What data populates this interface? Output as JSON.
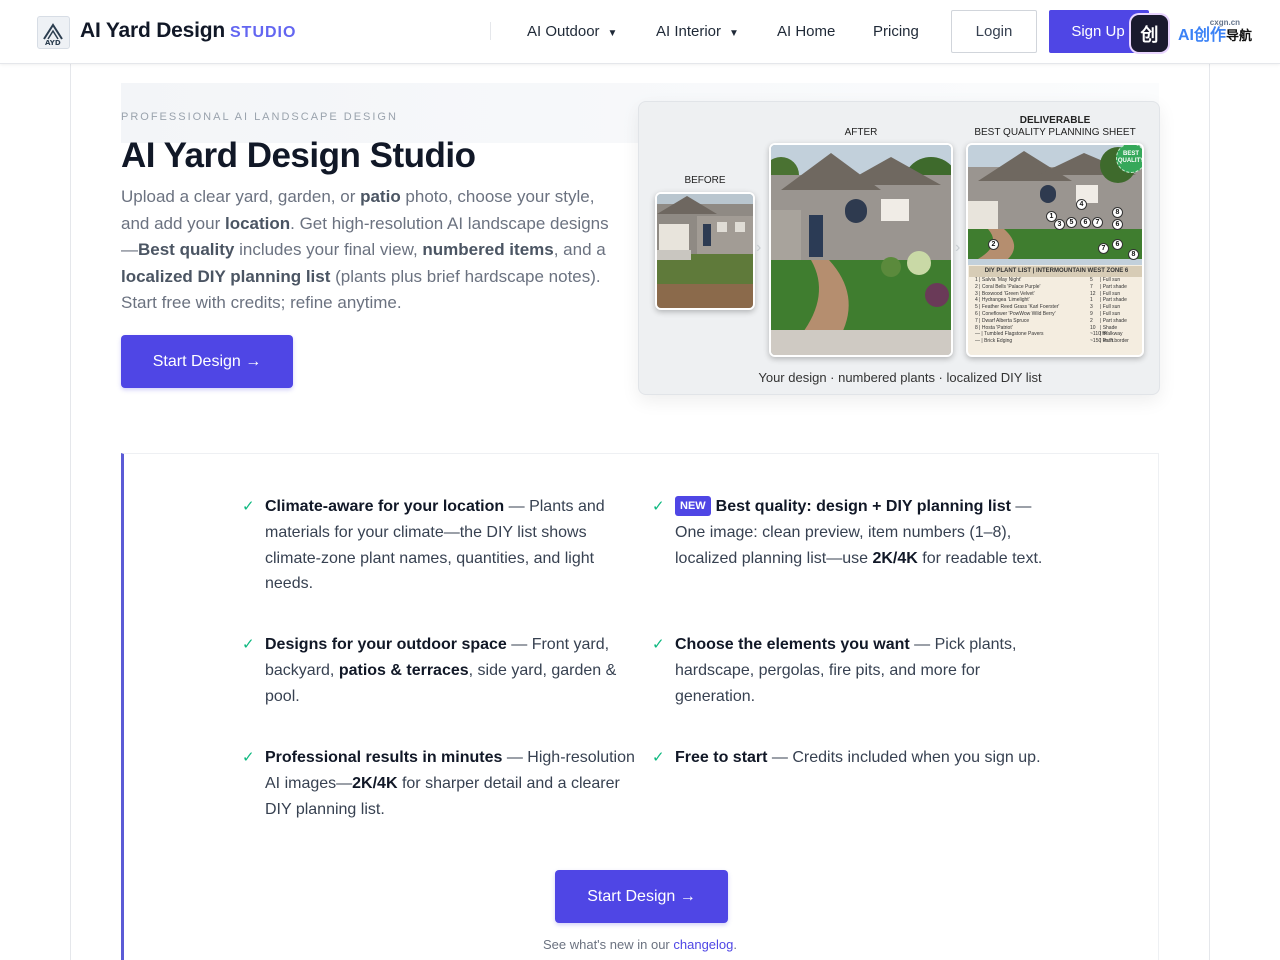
{
  "header": {
    "brand": "AI Yard Design",
    "brand_suffix": "STUDIO",
    "nav": [
      {
        "label": "AI Outdoor",
        "has_dropdown": true
      },
      {
        "label": "AI Interior",
        "has_dropdown": true
      },
      {
        "label": "AI Home",
        "has_dropdown": false
      },
      {
        "label": "Pricing",
        "has_dropdown": false
      }
    ],
    "login_label": "Login",
    "signup_label": "Sign Up",
    "app_badge_glyph": "创",
    "lang_badge": "AI创作",
    "lang_badge_sub": "导航",
    "lang_badge_small": "cxgn.cn"
  },
  "hero": {
    "eyebrow": "PROFESSIONAL AI LANDSCAPE DESIGN",
    "title": "AI Yard Design Studio",
    "desc_parts": [
      {
        "t": "Upload a clear yard, garden, or ",
        "b": false
      },
      {
        "t": "patio",
        "b": true
      },
      {
        "t": " photo, choose your style, and add your ",
        "b": false
      },
      {
        "t": "location",
        "b": true
      },
      {
        "t": ". Get high-resolution AI landscape designs —",
        "b": false
      },
      {
        "t": "Best quality",
        "b": true
      },
      {
        "t": " includes your final view, ",
        "b": false
      },
      {
        "t": "numbered items",
        "b": true
      },
      {
        "t": ", and a ",
        "b": false
      },
      {
        "t": "localized DIY planning list",
        "b": true
      },
      {
        "t": " (plants plus brief hardscape notes). Start free with credits; refine anytime.",
        "b": false
      }
    ],
    "cta_label": "Start Design →"
  },
  "showcase": {
    "before_label": "BEFORE",
    "after_label": "AFTER",
    "deliverable_label": "DELIVERABLE",
    "deliverable_sub": "BEST QUALITY PLANNING SHEET",
    "best_badge": "BEST QUALITY",
    "caption": "Your design · numbered plants · localized DIY list",
    "plan_list_title": "DIY PLANT LIST | INTERMOUNTAIN WEST ZONE 6",
    "plan_rows": [
      {
        "n": "1",
        "name": "Salvia 'May Night'",
        "q": "5",
        "l": "Full sun"
      },
      {
        "n": "2",
        "name": "Coral Bells 'Palace Purple'",
        "q": "7",
        "l": "Part shade"
      },
      {
        "n": "3",
        "name": "Boxwood 'Green Velvet'",
        "q": "12",
        "l": "Full sun"
      },
      {
        "n": "4",
        "name": "Hydrangea 'Limelight'",
        "q": "1",
        "l": "Part shade"
      },
      {
        "n": "5",
        "name": "Feather Reed Grass 'Karl Foerster'",
        "q": "3",
        "l": "Full sun"
      },
      {
        "n": "6",
        "name": "Coneflower 'PowWow Wild Berry'",
        "q": "9",
        "l": "Full sun"
      },
      {
        "n": "7",
        "name": "Dwarf Alberta Spruce",
        "q": "2",
        "l": "Part shade"
      },
      {
        "n": "8",
        "name": "Hosta 'Patriot'",
        "q": "10",
        "l": "Shade"
      },
      {
        "n": "—",
        "name": "Tumbled Flagstone Pavers",
        "q": "~110 ft²",
        "l": "Walkway"
      },
      {
        "n": "—",
        "name": "Brick Edging",
        "q": "~150 lin. ft.",
        "l": "Path border"
      }
    ],
    "pins": [
      "1",
      "2",
      "3",
      "4",
      "5",
      "6",
      "7",
      "8",
      "6",
      "7",
      "6",
      "8"
    ]
  },
  "features": [
    {
      "id": "climate",
      "parts": [
        {
          "t": "Climate-aware for your location",
          "b": true
        },
        {
          "t": " — Plants and materials for your climate—the DIY list shows climate-zone plant names, quantities, and light needs.",
          "b": false
        }
      ]
    },
    {
      "id": "best-quality",
      "new": "NEW",
      "parts": [
        {
          "t": "Best quality: design + DIY planning list",
          "b": true
        },
        {
          "t": " — One image: clean preview, item numbers (1–8), localized planning list—use ",
          "b": false
        },
        {
          "t": "2K/4K",
          "b": true
        },
        {
          "t": " for readable text.",
          "b": false
        }
      ]
    },
    {
      "id": "outdoor-space",
      "parts": [
        {
          "t": "Designs for your outdoor space",
          "b": true
        },
        {
          "t": " — Front yard, backyard, ",
          "b": false
        },
        {
          "t": "patios & terraces",
          "b": true
        },
        {
          "t": ", side yard, garden & pool.",
          "b": false
        }
      ]
    },
    {
      "id": "elements",
      "parts": [
        {
          "t": "Choose the elements you want",
          "b": true
        },
        {
          "t": " — Pick plants, hardscape, pergolas, fire pits, and more for generation.",
          "b": false
        }
      ]
    },
    {
      "id": "results",
      "parts": [
        {
          "t": "Professional results in minutes",
          "b": true
        },
        {
          "t": " — High-resolution AI images—",
          "b": false
        },
        {
          "t": "2K/4K",
          "b": true
        },
        {
          "t": " for sharper detail and a clearer DIY planning list.",
          "b": false
        }
      ]
    },
    {
      "id": "free",
      "parts": [
        {
          "t": "Free to start",
          "b": true
        },
        {
          "t": " — Credits included when you sign up.",
          "b": false
        }
      ]
    }
  ],
  "bottom": {
    "cta_label": "Start Design →",
    "changelog_prefix": "See what's new in our ",
    "changelog_link": "changelog",
    "changelog_suffix": "."
  },
  "colors": {
    "accent": "#4f46e5",
    "check": "#10b981",
    "studio": "#6366f1"
  }
}
